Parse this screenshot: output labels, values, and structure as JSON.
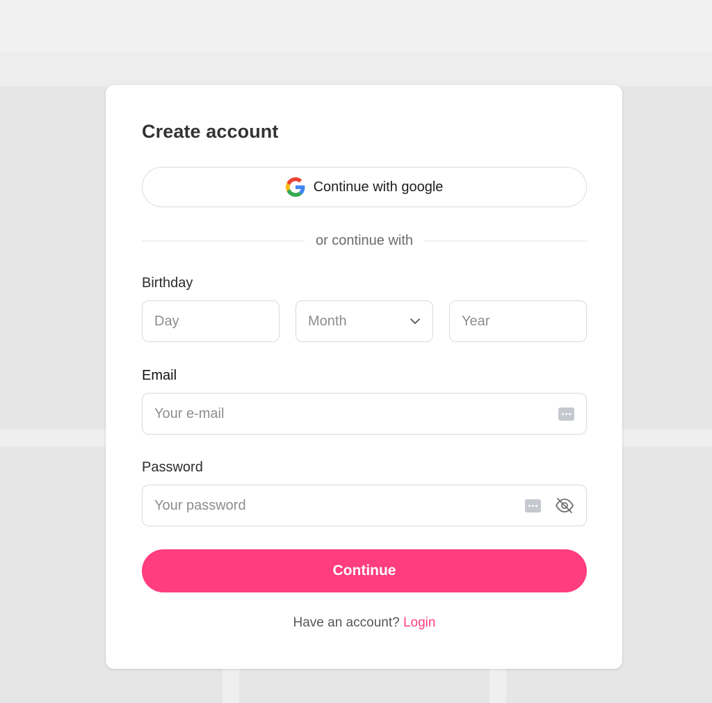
{
  "form": {
    "title": "Create account",
    "google_button_label": "Continue with google",
    "divider_text": "or continue with",
    "birthday": {
      "label": "Birthday",
      "day_placeholder": "Day",
      "month_value": "Month",
      "year_placeholder": "Year"
    },
    "email": {
      "label": "Email",
      "placeholder": "Your e-mail",
      "value": ""
    },
    "password": {
      "label": "Password",
      "placeholder": "Your password",
      "value": ""
    },
    "continue_label": "Continue",
    "footer": {
      "prompt": "Have an account?",
      "login_link": "Login"
    }
  },
  "icons": {
    "google": "google-logo-icon",
    "month_chevron": "chevron-down-icon",
    "email_autofill": "password-manager-icon",
    "password_autofill": "password-manager-icon",
    "password_toggle": "eye-off-icon"
  },
  "colors": {
    "accent": "#ff3d7f",
    "background": "#e6e6e6",
    "card": "#ffffff"
  }
}
